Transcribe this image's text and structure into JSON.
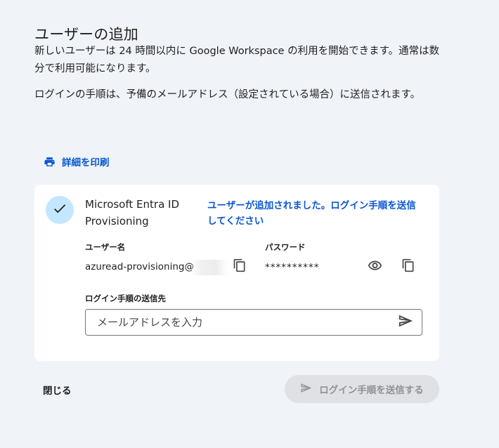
{
  "dialog": {
    "title": "ユーザーの追加",
    "description1": "新しいユーザーは 24 時間以内に Google Workspace の利用を開始できます。通常は数分で利用可能になります。",
    "description2": "ログインの手順は、予備のメールアドレス（設定されている場合）に送信されます。",
    "print_label": "詳細を印刷",
    "close_label": "閉じる",
    "send_label": "ログイン手順を送信する"
  },
  "user_card": {
    "name": "Microsoft Entra ID Provisioning",
    "success_message": "ユーザーが追加されました。ログイン手順を送信してください",
    "username_label": "ユーザー名",
    "username_value": "azuread-provisioning@",
    "password_label": "パスワード",
    "password_value": "**********",
    "destination_label": "ログイン手順の送信先",
    "email_placeholder": "メールアドレスを入力",
    "email_value": ""
  },
  "colors": {
    "background": "#f0f3f8",
    "accent": "#0b57d0",
    "check_circle": "#c2e7ff",
    "disabled_button": "#dfe1e5",
    "disabled_text": "#8e9196"
  },
  "icons": {
    "print": "printer-icon",
    "check": "check-icon",
    "copy": "copy-icon",
    "visibility": "eye-icon",
    "send": "send-icon"
  }
}
